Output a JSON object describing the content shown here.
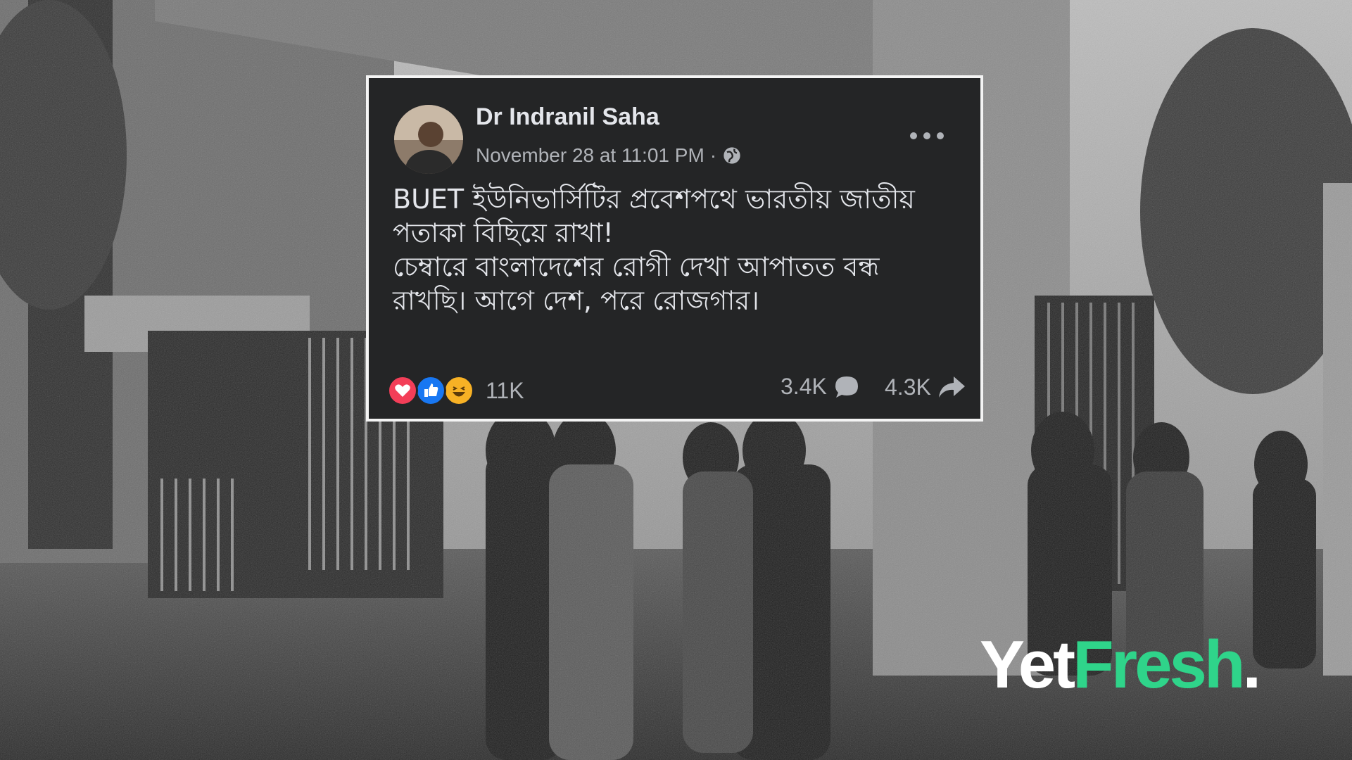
{
  "post": {
    "author": "Dr Indranil Saha",
    "timestamp": "November 28 at 11:01 PM",
    "separator": "·",
    "audience_icon": "globe-icon",
    "more_icon": "more-options-icon",
    "body_lines": [
      "BUET ইউনিভার্সিটির প্রবেশপথে ভারতীয় জাতীয়",
      "পতাকা বিছিয়ে রাখা!",
      "চেম্বারে বাংলাদেশের রোগী দেখা আপাতত বন্ধ",
      "রাখছি। আগে দেশ, পরে রোজগার।"
    ],
    "reactions": {
      "icons": [
        "love-reaction-icon",
        "like-reaction-icon",
        "haha-reaction-icon"
      ],
      "count": "11K"
    },
    "comments": "3.4K",
    "shares": "4.3K"
  },
  "brand": {
    "part1": "Yet",
    "part2": "Fresh",
    "part3": "."
  },
  "colors": {
    "card_bg": "#242526",
    "primary_text": "#e4e6eb",
    "secondary_text": "#b0b3b8",
    "brand_green": "#2fd48a",
    "love": "#f33e58",
    "like": "#1877f2",
    "haha": "#f7b125"
  }
}
